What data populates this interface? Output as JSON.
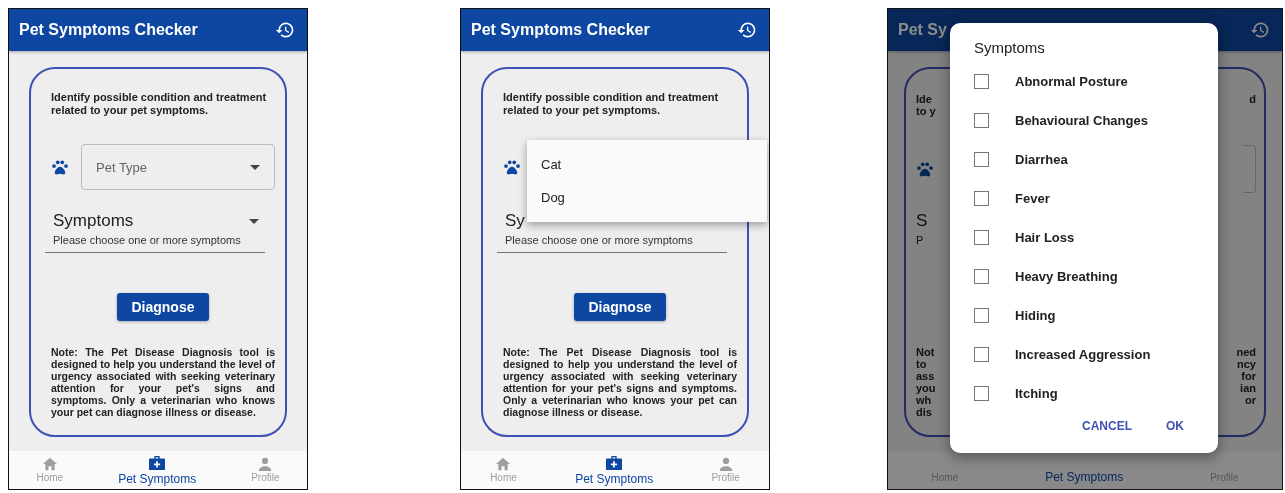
{
  "screens": [
    {
      "kind": "form",
      "title": "Pet Symptoms Checker",
      "intro": "Identify possible condition and treatment related to your pet symptoms.",
      "pet_type": {
        "placeholder": "Pet Type"
      },
      "symptoms": {
        "label": "Symptoms",
        "hint": "Please choose one or more symptoms"
      },
      "diagnose_button": "Diagnose",
      "note": "Note: The Pet Disease Diagnosis tool is designed to help you understand the level of urgency associated with seeking veterinary attention for your pet's signs and symptoms. Only a veterinarian who knows your pet can diagnose illness or disease.",
      "nav": [
        {
          "label": "Home",
          "selected": false
        },
        {
          "label": "Pet Symptoms",
          "selected": true
        },
        {
          "label": "Profile",
          "selected": false
        }
      ]
    },
    {
      "kind": "dropdown",
      "title": "Pet Symptoms Checker",
      "intro": "Identify possible condition and treatment related to your pet symptoms.",
      "menu": [
        "Cat",
        "Dog"
      ],
      "symptoms": {
        "label": "Sy",
        "hint": "Please choose one or more symptoms"
      },
      "diagnose_button": "Diagnose",
      "note": "Note: The Pet Disease Diagnosis tool is designed to help you understand the level of urgency associated with seeking veterinary attention for your pet's signs and symptoms. Only a veterinarian who knows your pet can diagnose illness or disease.",
      "nav": [
        {
          "label": "Home",
          "selected": false
        },
        {
          "label": "Pet Symptoms",
          "selected": true
        },
        {
          "label": "Profile",
          "selected": false
        }
      ]
    },
    {
      "kind": "dialog",
      "title": "Pet Sy",
      "fragments": {
        "intro_left": [
          "Ide",
          "to y"
        ],
        "intro_right": [
          "d"
        ],
        "symptoms_left": [
          "S",
          "P"
        ],
        "note_left": [
          "Not",
          "to",
          "ass",
          "you",
          "wh",
          "dis"
        ],
        "note_right": [
          "ned",
          "ncy",
          "for",
          "ian",
          "or"
        ]
      },
      "dialog": {
        "title": "Symptoms",
        "options": [
          {
            "label": "Abnormal Posture",
            "checked": false
          },
          {
            "label": "Behavioural Changes",
            "checked": false
          },
          {
            "label": "Diarrhea",
            "checked": false
          },
          {
            "label": "Fever",
            "checked": false
          },
          {
            "label": "Hair Loss",
            "checked": false
          },
          {
            "label": "Heavy Breathing",
            "checked": false
          },
          {
            "label": "Hiding",
            "checked": false
          },
          {
            "label": "Increased Aggression",
            "checked": false
          },
          {
            "label": "Itching",
            "checked": false
          }
        ],
        "buttons": [
          "CANCEL",
          "OK"
        ]
      },
      "nav": [
        {
          "label": "Home",
          "selected": false
        },
        {
          "label": "Pet Symptoms",
          "selected": true
        },
        {
          "label": "Profile",
          "selected": false
        }
      ]
    }
  ]
}
